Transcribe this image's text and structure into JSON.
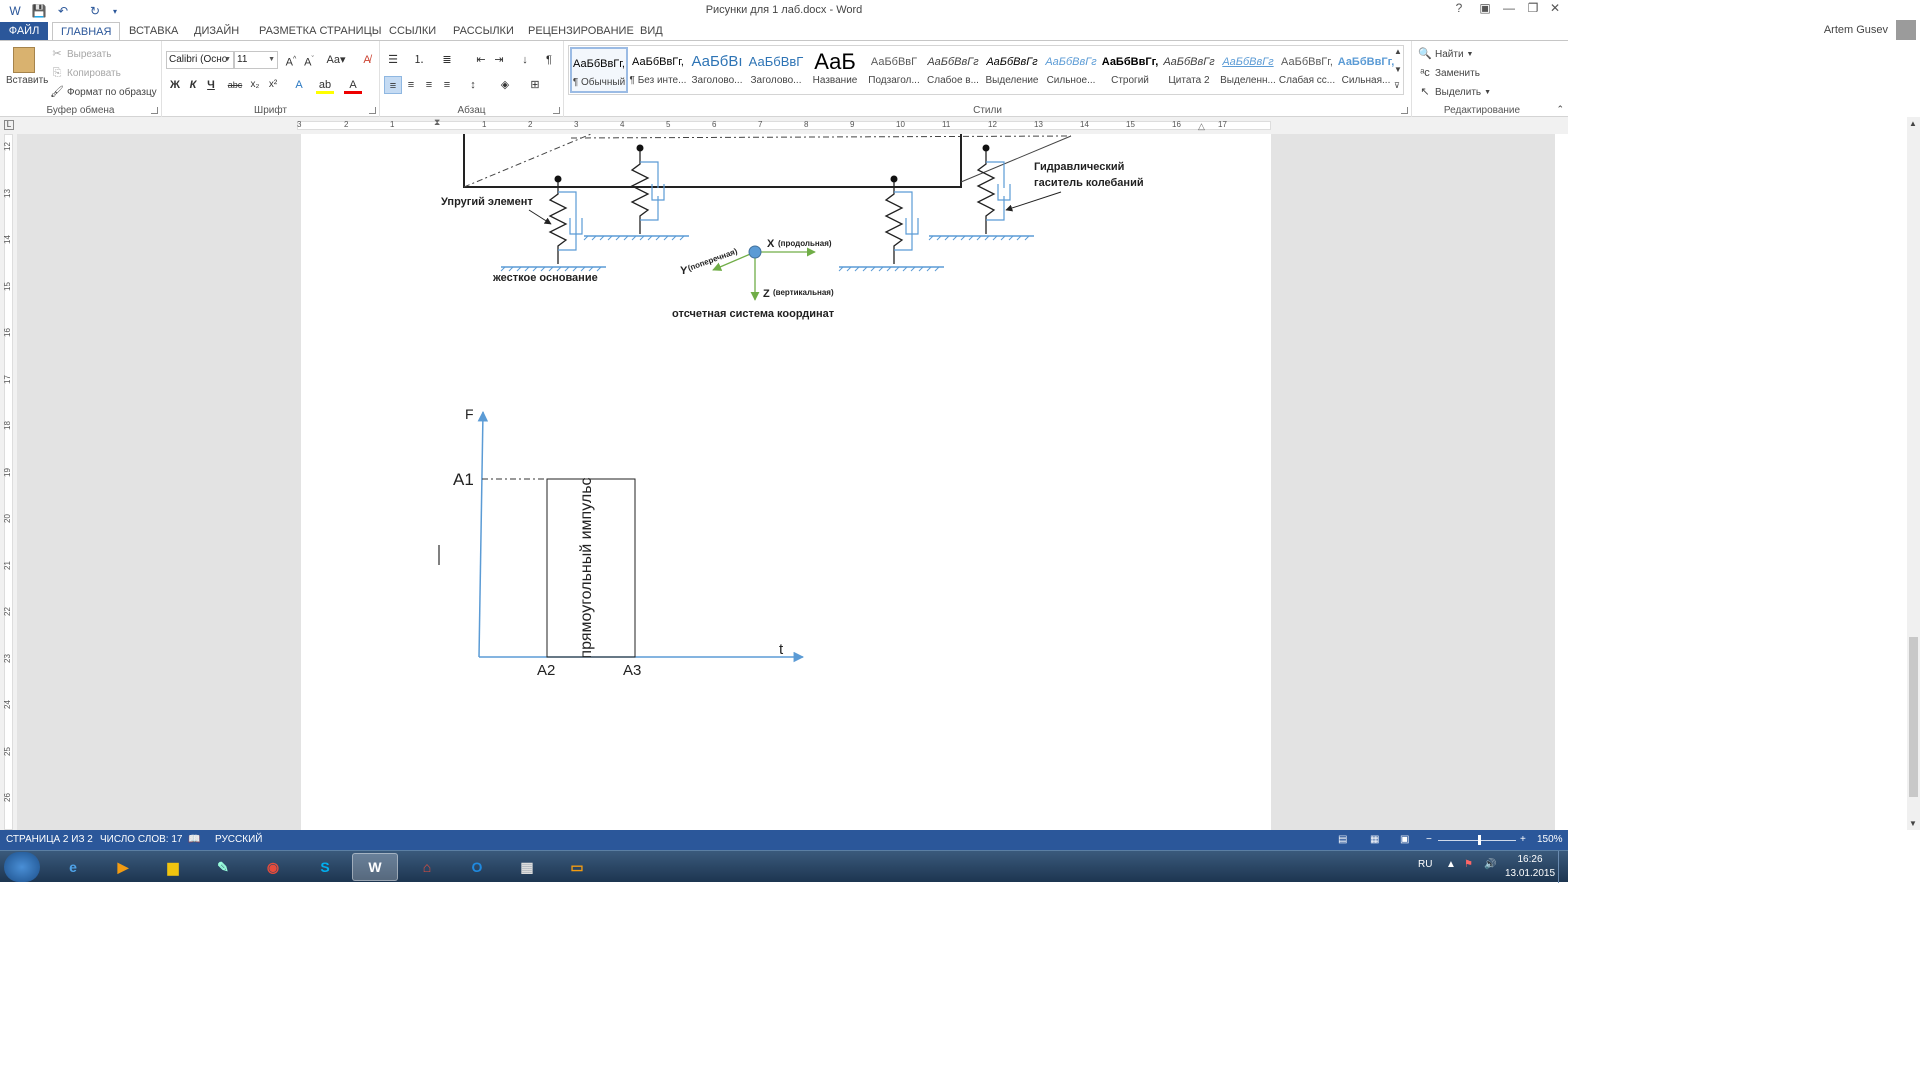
{
  "window": {
    "title": "Рисунки для 1 лаб.docx - Word",
    "user": "Artem Gusev",
    "help": "?"
  },
  "tabs": [
    "ФАЙЛ",
    "ГЛАВНАЯ",
    "ВСТАВКА",
    "ДИЗАЙН",
    "РАЗМЕТКА СТРАНИЦЫ",
    "ССЫЛКИ",
    "РАССЫЛКИ",
    "РЕЦЕНЗИРОВАНИЕ",
    "ВИД"
  ],
  "ribbon": {
    "clipboard": {
      "label": "Буфер обмена",
      "paste": "Вставить",
      "cut": "Вырезать",
      "copy": "Копировать",
      "format_painter": "Формат по образцу"
    },
    "font": {
      "label": "Шрифт",
      "font_name": "Calibri (Осно",
      "font_size": "11",
      "bold": "Ж",
      "italic": "К",
      "underline": "Ч",
      "strike": "abc",
      "sub": "x₂",
      "sup": "x²"
    },
    "paragraph": {
      "label": "Абзац"
    },
    "styles": {
      "label": "Стили",
      "items": [
        {
          "preview": "АаБбВвГг,",
          "name": "¶ Обычный"
        },
        {
          "preview": "АаБбВвГг,",
          "name": "¶ Без инте..."
        },
        {
          "preview": "АаБбВı",
          "name": "Заголово..."
        },
        {
          "preview": "АаБбВвГ",
          "name": "Заголово..."
        },
        {
          "preview": "АаБ",
          "name": "Название"
        },
        {
          "preview": "АаБбВвГ",
          "name": "Подзагол..."
        },
        {
          "preview": "АаБбВвГг",
          "name": "Слабое в..."
        },
        {
          "preview": "АаБбВвГг",
          "name": "Выделение"
        },
        {
          "preview": "АаБбВвГг",
          "name": "Сильное..."
        },
        {
          "preview": "АаБбВвГг,",
          "name": "Строгий"
        },
        {
          "preview": "АаБбВвГг",
          "name": "Цитата 2"
        },
        {
          "preview": "АаБбВвГг",
          "name": "Выделенн..."
        },
        {
          "preview": "АаБбВвГг,",
          "name": "Слабая сс..."
        },
        {
          "preview": "АаБбВвГг,",
          "name": "Сильная..."
        }
      ]
    },
    "editing": {
      "label": "Редактирование",
      "find": "Найти",
      "replace": "Заменить",
      "select": "Выделить"
    }
  },
  "ruler": {
    "h_ticks": [
      "3",
      "2",
      "1",
      "1",
      "2",
      "3",
      "4",
      "5",
      "6",
      "7",
      "8",
      "9",
      "10",
      "11",
      "12",
      "13",
      "14",
      "15",
      "16",
      "17"
    ],
    "v_ticks": [
      "12",
      "13",
      "14",
      "15",
      "16",
      "17",
      "18",
      "19",
      "20",
      "21",
      "22",
      "23",
      "24",
      "25",
      "26"
    ]
  },
  "figure1": {
    "label_elastic": "Упругий элемент",
    "label_base": "жесткое основание",
    "label_damper_1": "Гидравлический",
    "label_damper_2": "гаситель колебаний",
    "axis_x": "X",
    "axis_x_note": "(продольная)",
    "axis_y": "Y",
    "axis_y_note": "(поперечная)",
    "axis_z": "Z",
    "axis_z_note": "(вертикальная)",
    "caption": "отсчетная система координат"
  },
  "figure2": {
    "axis_f": "F",
    "axis_t": "t",
    "a1": "A1",
    "a2": "A2",
    "a3": "A3",
    "pulse_label": "прямоугольный импульс"
  },
  "status": {
    "page": "СТРАНИЦА 2 ИЗ 2",
    "words": "ЧИСЛО СЛОВ: 17",
    "lang": "РУССКИЙ",
    "zoom": "150%"
  },
  "tray": {
    "lang": "RU",
    "time": "16:26",
    "date": "13.01.2015"
  },
  "colors": {
    "accent": "#2b579a",
    "diagram_blue": "#5b9bd5",
    "diagram_green": "#70ad47"
  }
}
